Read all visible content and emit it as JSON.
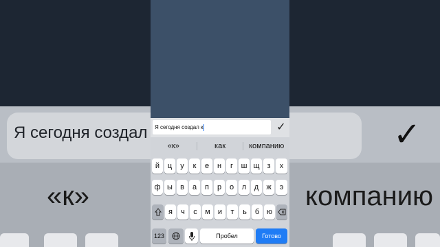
{
  "background": {
    "input_text": "Я сегодня создал",
    "suggestion_left": "«к»",
    "suggestion_right": "компанию"
  },
  "input": {
    "value": "Я сегодня создал к"
  },
  "suggestions": [
    "«к»",
    "как",
    "компанию"
  ],
  "keyboard": {
    "row1": [
      "й",
      "ц",
      "у",
      "к",
      "е",
      "н",
      "г",
      "ш",
      "щ",
      "з",
      "х"
    ],
    "row2": [
      "ф",
      "ы",
      "в",
      "а",
      "п",
      "р",
      "о",
      "л",
      "д",
      "ж",
      "э"
    ],
    "row3": [
      "я",
      "ч",
      "с",
      "м",
      "и",
      "т",
      "ь",
      "б",
      "ю"
    ],
    "numbers_label": "123",
    "space_label": "Пробел",
    "done_label": "Готово"
  },
  "colors": {
    "chat_bg": "#3c5068",
    "keyboard_bg": "#d1d4d9",
    "done_button": "#1f7cf5",
    "caret": "#2a7cf7"
  },
  "icons": {
    "send": "checkmark-icon",
    "shift": "shift-icon",
    "backspace": "backspace-icon",
    "globe": "globe-icon",
    "mic": "microphone-icon"
  }
}
